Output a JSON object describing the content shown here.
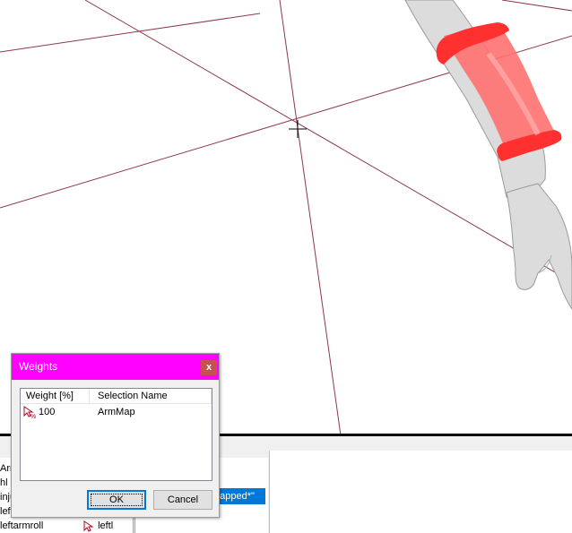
{
  "dialog": {
    "title": "Weights",
    "close_label": "x",
    "columns": [
      "Weight [%]",
      "Selection Name"
    ],
    "rows": [
      {
        "weight": "100",
        "selection": "ArmMap"
      }
    ],
    "ok_label": "OK",
    "cancel_label": "Cancel",
    "title_color": "#ff00ff"
  },
  "background_list": {
    "items": [
      "Arr",
      "hl",
      "inju",
      "left",
      "left",
      "leftarmroll"
    ],
    "arrow_cell": "leftl",
    "selected_item": "mapped*\""
  },
  "icons": {
    "weight_row": "arrow-cursor-percent-icon",
    "list_row": "arrow-cursor-icon"
  }
}
